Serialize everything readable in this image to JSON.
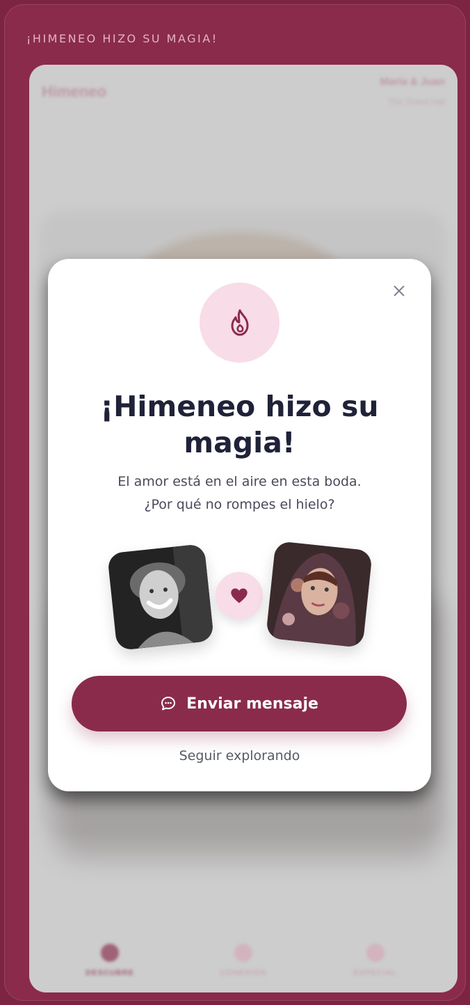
{
  "frame": {
    "title": "¡HIMENEO HIZO SU MAGIA!"
  },
  "app_header": {
    "brand": "Himeneo",
    "couple": "María & Juan",
    "venue": "The Grand Hall"
  },
  "bottom_nav": [
    {
      "label": "DESCUBRE",
      "active": true
    },
    {
      "label": "CONEXIÓN",
      "active": false
    },
    {
      "label": "ESPECIAL",
      "active": false
    }
  ],
  "modal": {
    "title": "¡Himeneo hizo su magia!",
    "subtitle_line1": "El amor está en el aire en esta boda.",
    "subtitle_line2": "¿Por qué no rompes el hielo?",
    "primary_button": "Enviar mensaje",
    "secondary_link": "Seguir explorando",
    "icons": {
      "top": "flame-icon",
      "center": "heart-icon",
      "button": "chat-bubble-icon",
      "close": "close-icon"
    }
  },
  "colors": {
    "brand": "#8a2b4b",
    "accent_soft": "#f8dce8",
    "title_text": "#1f2238",
    "body_text": "#4a4a5a"
  }
}
